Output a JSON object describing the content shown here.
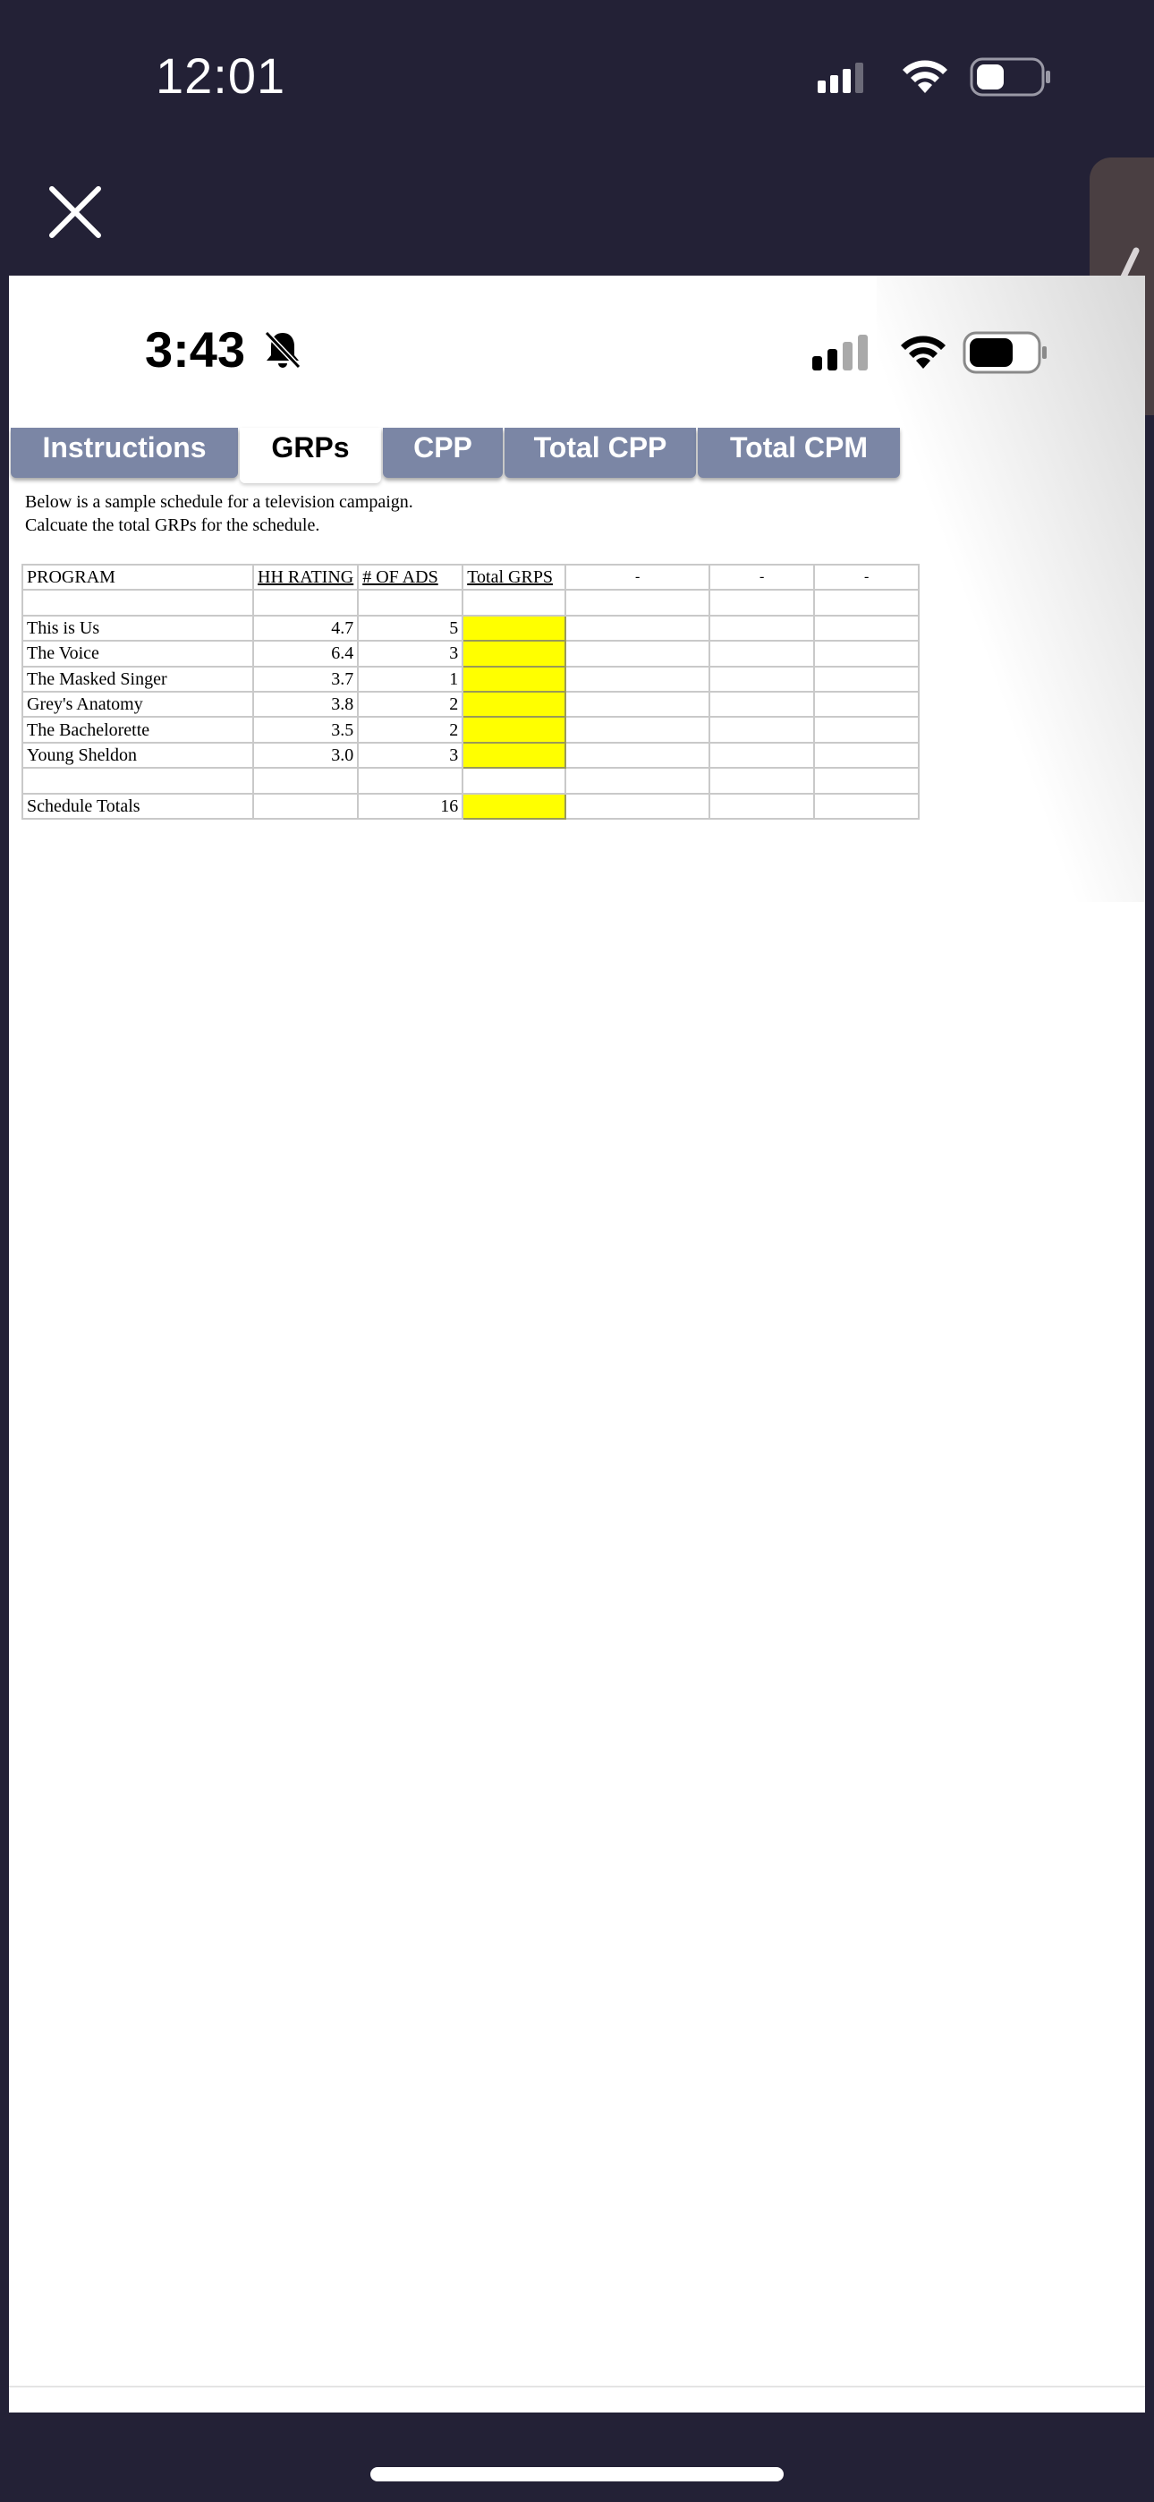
{
  "outer_status": {
    "time": "12:01"
  },
  "inner_status": {
    "time": "3:43"
  },
  "tabs": [
    {
      "label": "Instructions",
      "active": false
    },
    {
      "label": "GRPs",
      "active": true
    },
    {
      "label": "CPP",
      "active": false
    },
    {
      "label": "Total CPP",
      "active": false
    },
    {
      "label": "Total CPM",
      "active": false
    }
  ],
  "instructions": {
    "line1": "Below is a sample schedule for a television campaign.",
    "line2": "Calcuate the total GRPs for the schedule."
  },
  "grid": {
    "headers": {
      "program": "PROGRAM",
      "rating": "HH RATING",
      "ads": "# OF ADS",
      "grps": "Total GRPS",
      "extra1": "-",
      "extra2": "-",
      "extra3": "-"
    },
    "rows": [
      {
        "program": "This is Us",
        "rating": "4.7",
        "ads": "5"
      },
      {
        "program": "The Voice",
        "rating": "6.4",
        "ads": "3"
      },
      {
        "program": "The Masked Singer",
        "rating": "3.7",
        "ads": "1"
      },
      {
        "program": "Grey's Anatomy",
        "rating": "3.8",
        "ads": "2"
      },
      {
        "program": "The Bachelorette",
        "rating": "3.5",
        "ads": "2"
      },
      {
        "program": "Young Sheldon",
        "rating": "3.0",
        "ads": "3"
      }
    ],
    "totals": {
      "label": "Schedule Totals",
      "ads": "16"
    }
  },
  "colors": {
    "background": "#232136",
    "tab_inactive": "#7b86a5",
    "answer_cell": "#ffff00"
  }
}
